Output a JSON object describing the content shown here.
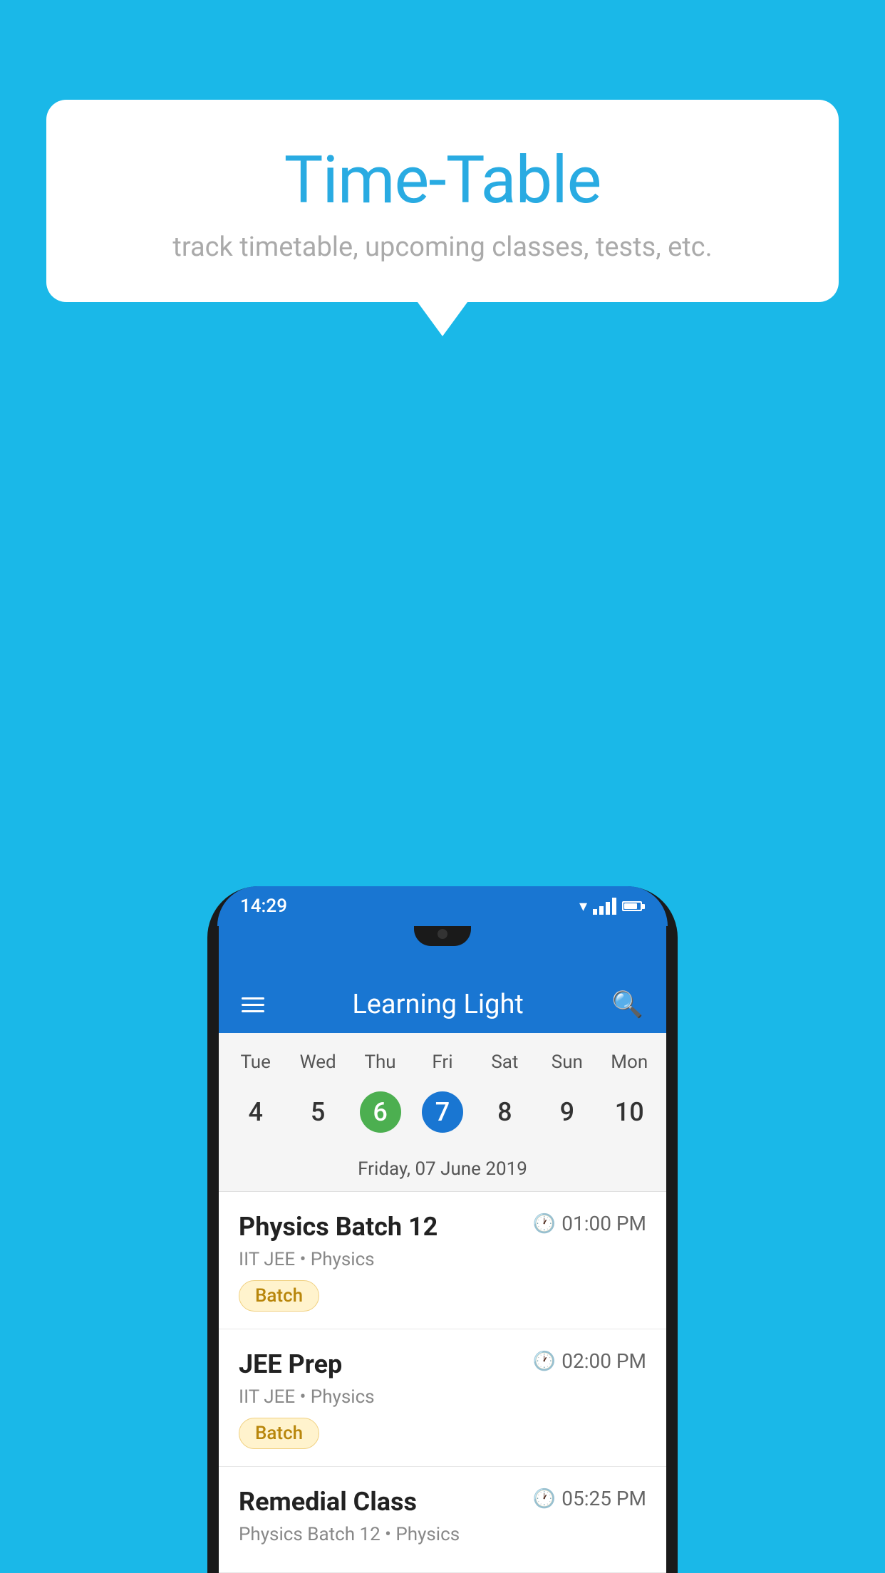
{
  "background_color": "#1ab8e8",
  "header": {
    "title": "Time-Table",
    "subtitle": "track timetable, upcoming classes, tests, etc."
  },
  "app": {
    "name": "Learning Light",
    "status_time": "14:29"
  },
  "calendar": {
    "days": [
      "Tue",
      "Wed",
      "Thu",
      "Fri",
      "Sat",
      "Sun",
      "Mon"
    ],
    "dates": [
      "4",
      "5",
      "6",
      "7",
      "8",
      "9",
      "10"
    ],
    "today_green_index": 2,
    "today_blue_index": 3,
    "selected_date": "Friday, 07 June 2019"
  },
  "schedule": [
    {
      "title": "Physics Batch 12",
      "time": "01:00 PM",
      "sub": "IIT JEE • Physics",
      "tag": "Batch"
    },
    {
      "title": "JEE Prep",
      "time": "02:00 PM",
      "sub": "IIT JEE • Physics",
      "tag": "Batch"
    },
    {
      "title": "Remedial Class",
      "time": "05:25 PM",
      "sub": "Physics Batch 12 • Physics",
      "tag": ""
    }
  ]
}
